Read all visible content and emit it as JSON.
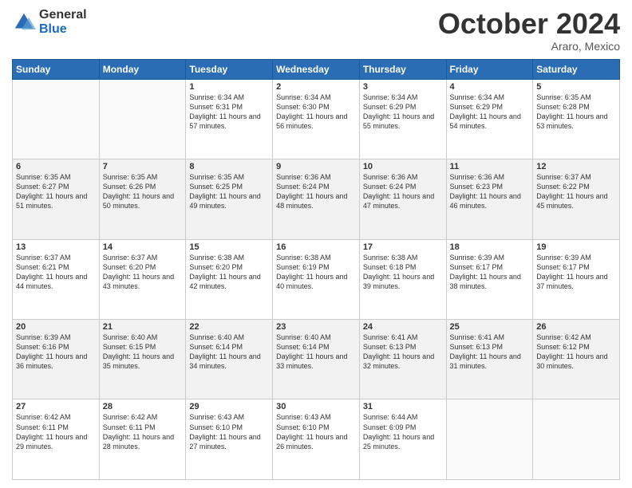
{
  "logo": {
    "general": "General",
    "blue": "Blue"
  },
  "header": {
    "month": "October 2024",
    "location": "Araro, Mexico"
  },
  "weekdays": [
    "Sunday",
    "Monday",
    "Tuesday",
    "Wednesday",
    "Thursday",
    "Friday",
    "Saturday"
  ],
  "weeks": [
    [
      {
        "day": "",
        "sunrise": "",
        "sunset": "",
        "daylight": ""
      },
      {
        "day": "",
        "sunrise": "",
        "sunset": "",
        "daylight": ""
      },
      {
        "day": "1",
        "sunrise": "Sunrise: 6:34 AM",
        "sunset": "Sunset: 6:31 PM",
        "daylight": "Daylight: 11 hours and 57 minutes."
      },
      {
        "day": "2",
        "sunrise": "Sunrise: 6:34 AM",
        "sunset": "Sunset: 6:30 PM",
        "daylight": "Daylight: 11 hours and 56 minutes."
      },
      {
        "day": "3",
        "sunrise": "Sunrise: 6:34 AM",
        "sunset": "Sunset: 6:29 PM",
        "daylight": "Daylight: 11 hours and 55 minutes."
      },
      {
        "day": "4",
        "sunrise": "Sunrise: 6:34 AM",
        "sunset": "Sunset: 6:29 PM",
        "daylight": "Daylight: 11 hours and 54 minutes."
      },
      {
        "day": "5",
        "sunrise": "Sunrise: 6:35 AM",
        "sunset": "Sunset: 6:28 PM",
        "daylight": "Daylight: 11 hours and 53 minutes."
      }
    ],
    [
      {
        "day": "6",
        "sunrise": "Sunrise: 6:35 AM",
        "sunset": "Sunset: 6:27 PM",
        "daylight": "Daylight: 11 hours and 51 minutes."
      },
      {
        "day": "7",
        "sunrise": "Sunrise: 6:35 AM",
        "sunset": "Sunset: 6:26 PM",
        "daylight": "Daylight: 11 hours and 50 minutes."
      },
      {
        "day": "8",
        "sunrise": "Sunrise: 6:35 AM",
        "sunset": "Sunset: 6:25 PM",
        "daylight": "Daylight: 11 hours and 49 minutes."
      },
      {
        "day": "9",
        "sunrise": "Sunrise: 6:36 AM",
        "sunset": "Sunset: 6:24 PM",
        "daylight": "Daylight: 11 hours and 48 minutes."
      },
      {
        "day": "10",
        "sunrise": "Sunrise: 6:36 AM",
        "sunset": "Sunset: 6:24 PM",
        "daylight": "Daylight: 11 hours and 47 minutes."
      },
      {
        "day": "11",
        "sunrise": "Sunrise: 6:36 AM",
        "sunset": "Sunset: 6:23 PM",
        "daylight": "Daylight: 11 hours and 46 minutes."
      },
      {
        "day": "12",
        "sunrise": "Sunrise: 6:37 AM",
        "sunset": "Sunset: 6:22 PM",
        "daylight": "Daylight: 11 hours and 45 minutes."
      }
    ],
    [
      {
        "day": "13",
        "sunrise": "Sunrise: 6:37 AM",
        "sunset": "Sunset: 6:21 PM",
        "daylight": "Daylight: 11 hours and 44 minutes."
      },
      {
        "day": "14",
        "sunrise": "Sunrise: 6:37 AM",
        "sunset": "Sunset: 6:20 PM",
        "daylight": "Daylight: 11 hours and 43 minutes."
      },
      {
        "day": "15",
        "sunrise": "Sunrise: 6:38 AM",
        "sunset": "Sunset: 6:20 PM",
        "daylight": "Daylight: 11 hours and 42 minutes."
      },
      {
        "day": "16",
        "sunrise": "Sunrise: 6:38 AM",
        "sunset": "Sunset: 6:19 PM",
        "daylight": "Daylight: 11 hours and 40 minutes."
      },
      {
        "day": "17",
        "sunrise": "Sunrise: 6:38 AM",
        "sunset": "Sunset: 6:18 PM",
        "daylight": "Daylight: 11 hours and 39 minutes."
      },
      {
        "day": "18",
        "sunrise": "Sunrise: 6:39 AM",
        "sunset": "Sunset: 6:17 PM",
        "daylight": "Daylight: 11 hours and 38 minutes."
      },
      {
        "day": "19",
        "sunrise": "Sunrise: 6:39 AM",
        "sunset": "Sunset: 6:17 PM",
        "daylight": "Daylight: 11 hours and 37 minutes."
      }
    ],
    [
      {
        "day": "20",
        "sunrise": "Sunrise: 6:39 AM",
        "sunset": "Sunset: 6:16 PM",
        "daylight": "Daylight: 11 hours and 36 minutes."
      },
      {
        "day": "21",
        "sunrise": "Sunrise: 6:40 AM",
        "sunset": "Sunset: 6:15 PM",
        "daylight": "Daylight: 11 hours and 35 minutes."
      },
      {
        "day": "22",
        "sunrise": "Sunrise: 6:40 AM",
        "sunset": "Sunset: 6:14 PM",
        "daylight": "Daylight: 11 hours and 34 minutes."
      },
      {
        "day": "23",
        "sunrise": "Sunrise: 6:40 AM",
        "sunset": "Sunset: 6:14 PM",
        "daylight": "Daylight: 11 hours and 33 minutes."
      },
      {
        "day": "24",
        "sunrise": "Sunrise: 6:41 AM",
        "sunset": "Sunset: 6:13 PM",
        "daylight": "Daylight: 11 hours and 32 minutes."
      },
      {
        "day": "25",
        "sunrise": "Sunrise: 6:41 AM",
        "sunset": "Sunset: 6:13 PM",
        "daylight": "Daylight: 11 hours and 31 minutes."
      },
      {
        "day": "26",
        "sunrise": "Sunrise: 6:42 AM",
        "sunset": "Sunset: 6:12 PM",
        "daylight": "Daylight: 11 hours and 30 minutes."
      }
    ],
    [
      {
        "day": "27",
        "sunrise": "Sunrise: 6:42 AM",
        "sunset": "Sunset: 6:11 PM",
        "daylight": "Daylight: 11 hours and 29 minutes."
      },
      {
        "day": "28",
        "sunrise": "Sunrise: 6:42 AM",
        "sunset": "Sunset: 6:11 PM",
        "daylight": "Daylight: 11 hours and 28 minutes."
      },
      {
        "day": "29",
        "sunrise": "Sunrise: 6:43 AM",
        "sunset": "Sunset: 6:10 PM",
        "daylight": "Daylight: 11 hours and 27 minutes."
      },
      {
        "day": "30",
        "sunrise": "Sunrise: 6:43 AM",
        "sunset": "Sunset: 6:10 PM",
        "daylight": "Daylight: 11 hours and 26 minutes."
      },
      {
        "day": "31",
        "sunrise": "Sunrise: 6:44 AM",
        "sunset": "Sunset: 6:09 PM",
        "daylight": "Daylight: 11 hours and 25 minutes."
      },
      {
        "day": "",
        "sunrise": "",
        "sunset": "",
        "daylight": ""
      },
      {
        "day": "",
        "sunrise": "",
        "sunset": "",
        "daylight": ""
      }
    ]
  ]
}
